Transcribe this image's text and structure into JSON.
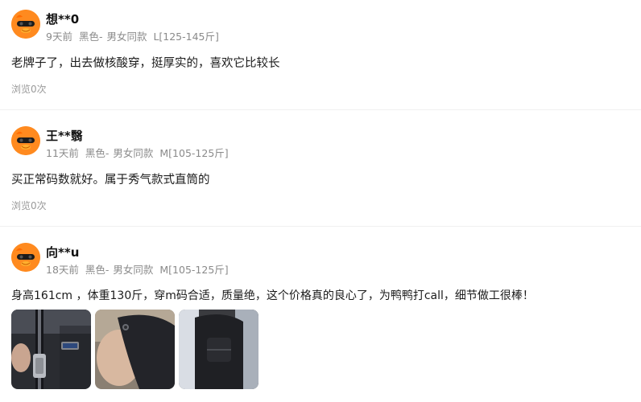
{
  "reviews": [
    {
      "username": "想**0",
      "time": "9天前",
      "color": "黑色-",
      "style": "男女同款",
      "size": "L[125-145斤]",
      "content": "老牌子了，出去做核酸穿，挺厚实的，喜欢它比较长",
      "views": "浏览0次"
    },
    {
      "username": "王**翳",
      "time": "11天前",
      "color": "黑色-",
      "style": "男女同款",
      "size": "M[105-125斤]",
      "content": "买正常码数就好。属于秀气款式直筒的",
      "views": "浏览0次"
    },
    {
      "username": "向**u",
      "time": "18天前",
      "color": "黑色-",
      "style": "男女同款",
      "size": "M[105-125斤]",
      "content": "身高161cm ，体重130斤，穿m码合适，质量绝，这个价格真的良心了，为鸭鸭打call，细节做工很棒！",
      "photos": [
        "zipper-photo",
        "cuff-button-photo",
        "collar-photo"
      ]
    }
  ]
}
